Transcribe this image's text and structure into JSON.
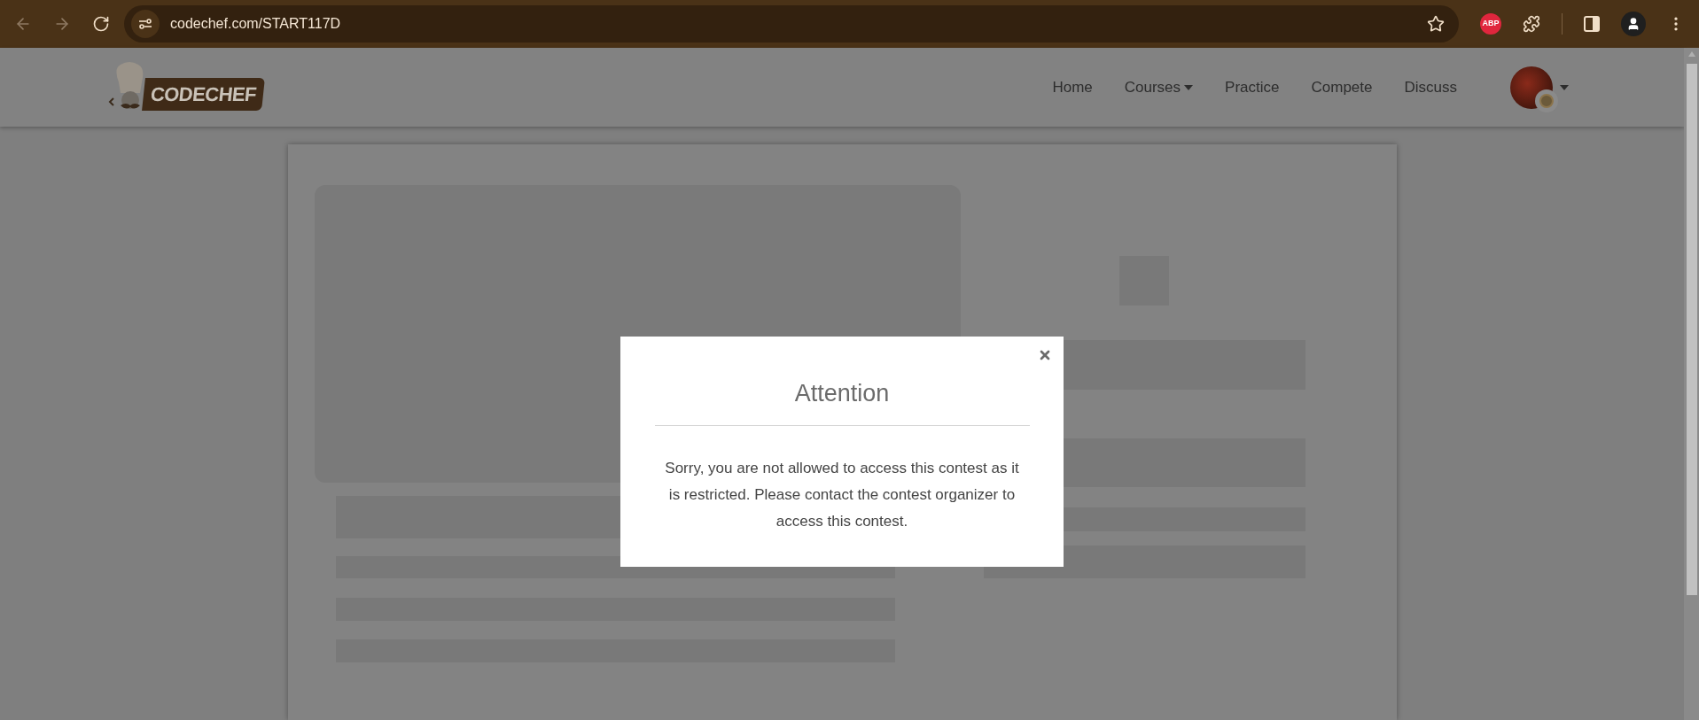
{
  "browser": {
    "url": "codechef.com/START117D",
    "adblock_badge": "ABP"
  },
  "site": {
    "logo": "CODECHEF",
    "nav": [
      {
        "label": "Home",
        "kind": "link"
      },
      {
        "label": "Courses",
        "kind": "dropdown"
      },
      {
        "label": "Practice",
        "kind": "link"
      },
      {
        "label": "Compete",
        "kind": "link"
      },
      {
        "label": "Discuss",
        "kind": "link"
      }
    ]
  },
  "modal": {
    "title": "Attention",
    "message": "Sorry, you are not allowed to access this contest as it is restricted. Please contact the contest organizer to access this contest."
  }
}
